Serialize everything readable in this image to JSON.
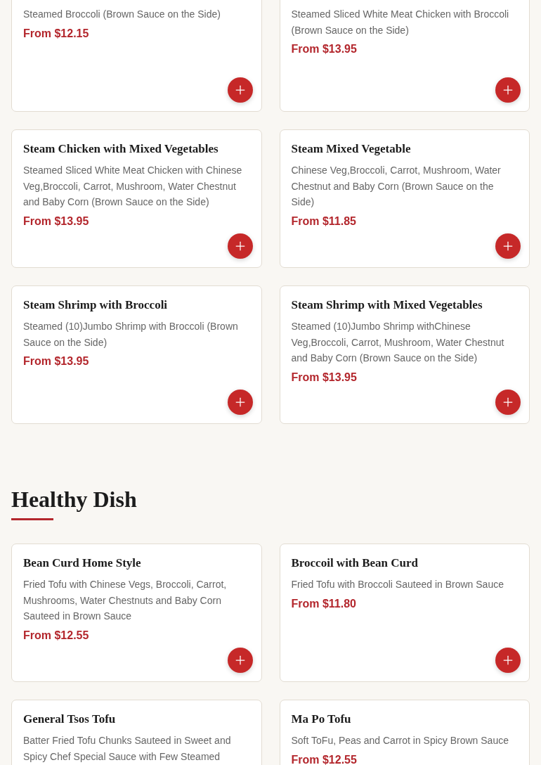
{
  "sections": [
    {
      "items": [
        {
          "description": "Steamed Broccoli (Brown Sauce on the Side)",
          "price": "From $12.15",
          "add_button": true
        },
        {
          "description": "Steamed Sliced White Meat Chicken with Broccoli (Brown Sauce on the Side)",
          "price": "From $13.95",
          "add_button": true
        },
        {
          "title": "Steam Chicken with Mixed Vegetables",
          "description": "Steamed Sliced White Meat Chicken with Chinese Veg,Broccoli, Carrot, Mushroom, Water Chestnut and Baby Corn (Brown Sauce on the Side)",
          "price": "From $13.95",
          "add_button": true
        },
        {
          "title": "Steam Mixed Vegetable",
          "description": "Chinese Veg,Broccoli, Carrot, Mushroom, Water Chestnut and Baby Corn (Brown Sauce on the Side)",
          "price": "From $11.85",
          "add_button": true
        },
        {
          "title": "Steam Shrimp with Broccoli",
          "description": "Steamed (10)Jumbo Shrimp with Broccoli (Brown Sauce on the Side)",
          "price": "From $13.95",
          "add_button": true
        },
        {
          "title": "Steam Shrimp with Mixed Vegetables",
          "description": "Steamed (10)Jumbo Shrimp withChinese Veg,Broccoli, Carrot, Mushroom, Water Chestnut and Baby Corn (Brown Sauce on the Side)",
          "price": "From $13.95",
          "add_button": true
        }
      ]
    },
    {
      "heading": "Healthy Dish",
      "items": [
        {
          "title": "Bean Curd Home Style",
          "description": "Fried Tofu with Chinese Vegs, Broccoli, Carrot, Mushrooms, Water Chestnuts and Baby Corn Sauteed in Brown Sauce",
          "price": "From $12.55",
          "add_button": true
        },
        {
          "title": "Broccoil with Bean Curd",
          "description": "Fried Tofu with Broccoli Sauteed in Brown Sauce",
          "price": "From $11.80",
          "add_button": true
        },
        {
          "title": "General Tsos Tofu",
          "description": "Batter Fried Tofu Chunks Sauteed in Sweet and Spicy Chef Special Sauce with Few Steamed"
        },
        {
          "title": "Ma Po Tofu",
          "description": "Soft ToFu, Peas and Carrot in Spicy Brown Sauce",
          "price": "From $12.55"
        }
      ]
    }
  ]
}
